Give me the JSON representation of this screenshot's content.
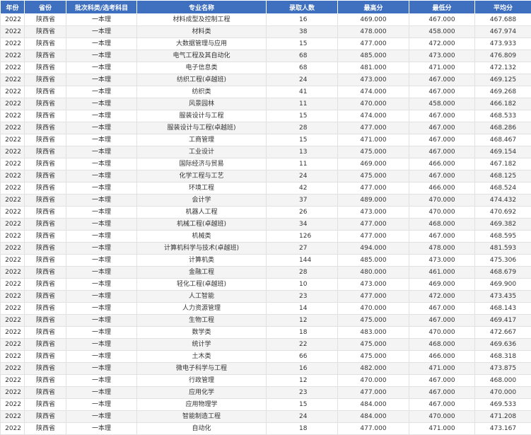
{
  "table": {
    "headers": [
      "年份",
      "省份",
      "批次科类/选考科目",
      "专业名称",
      "录取人数",
      "最高分",
      "最低分",
      "平均分"
    ],
    "rows": [
      [
        "2022",
        "陕西省",
        "一本理",
        "材料成型及控制工程",
        "16",
        "469.000",
        "467.000",
        "467.688"
      ],
      [
        "2022",
        "陕西省",
        "一本理",
        "材料类",
        "38",
        "478.000",
        "458.000",
        "467.974"
      ],
      [
        "2022",
        "陕西省",
        "一本理",
        "大数据管理与应用",
        "15",
        "477.000",
        "472.000",
        "473.933"
      ],
      [
        "2022",
        "陕西省",
        "一本理",
        "电气工程及其自动化",
        "68",
        "485.000",
        "473.000",
        "476.809"
      ],
      [
        "2022",
        "陕西省",
        "一本理",
        "电子信息类",
        "68",
        "481.000",
        "471.000",
        "472.132"
      ],
      [
        "2022",
        "陕西省",
        "一本理",
        "纺织工程(卓越班)",
        "24",
        "473.000",
        "467.000",
        "469.125"
      ],
      [
        "2022",
        "陕西省",
        "一本理",
        "纺织类",
        "41",
        "474.000",
        "467.000",
        "469.268"
      ],
      [
        "2022",
        "陕西省",
        "一本理",
        "风景园林",
        "11",
        "470.000",
        "458.000",
        "466.182"
      ],
      [
        "2022",
        "陕西省",
        "一本理",
        "服装设计与工程",
        "15",
        "474.000",
        "467.000",
        "468.533"
      ],
      [
        "2022",
        "陕西省",
        "一本理",
        "服装设计与工程(卓越班)",
        "28",
        "477.000",
        "467.000",
        "468.286"
      ],
      [
        "2022",
        "陕西省",
        "一本理",
        "工商管理",
        "15",
        "471.000",
        "467.000",
        "468.467"
      ],
      [
        "2022",
        "陕西省",
        "一本理",
        "工业设计",
        "13",
        "475.000",
        "467.000",
        "469.154"
      ],
      [
        "2022",
        "陕西省",
        "一本理",
        "国际经济与贸易",
        "11",
        "469.000",
        "466.000",
        "467.182"
      ],
      [
        "2022",
        "陕西省",
        "一本理",
        "化学工程与工艺",
        "24",
        "475.000",
        "467.000",
        "468.125"
      ],
      [
        "2022",
        "陕西省",
        "一本理",
        "环境工程",
        "42",
        "477.000",
        "466.000",
        "468.524"
      ],
      [
        "2022",
        "陕西省",
        "一本理",
        "会计学",
        "37",
        "489.000",
        "470.000",
        "474.432"
      ],
      [
        "2022",
        "陕西省",
        "一本理",
        "机器人工程",
        "26",
        "473.000",
        "470.000",
        "470.692"
      ],
      [
        "2022",
        "陕西省",
        "一本理",
        "机械工程(卓越班)",
        "34",
        "477.000",
        "468.000",
        "469.382"
      ],
      [
        "2022",
        "陕西省",
        "一本理",
        "机械类",
        "126",
        "477.000",
        "467.000",
        "468.595"
      ],
      [
        "2022",
        "陕西省",
        "一本理",
        "计算机科学与技术(卓越班)",
        "27",
        "494.000",
        "478.000",
        "481.593"
      ],
      [
        "2022",
        "陕西省",
        "一本理",
        "计算机类",
        "144",
        "485.000",
        "473.000",
        "475.306"
      ],
      [
        "2022",
        "陕西省",
        "一本理",
        "金融工程",
        "28",
        "480.000",
        "461.000",
        "468.679"
      ],
      [
        "2022",
        "陕西省",
        "一本理",
        "轻化工程(卓越班)",
        "10",
        "473.000",
        "469.000",
        "469.900"
      ],
      [
        "2022",
        "陕西省",
        "一本理",
        "人工智能",
        "23",
        "477.000",
        "472.000",
        "473.435"
      ],
      [
        "2022",
        "陕西省",
        "一本理",
        "人力资源管理",
        "14",
        "470.000",
        "467.000",
        "468.143"
      ],
      [
        "2022",
        "陕西省",
        "一本理",
        "生物工程",
        "12",
        "475.000",
        "467.000",
        "469.417"
      ],
      [
        "2022",
        "陕西省",
        "一本理",
        "数学类",
        "18",
        "483.000",
        "470.000",
        "472.667"
      ],
      [
        "2022",
        "陕西省",
        "一本理",
        "统计学",
        "22",
        "475.000",
        "468.000",
        "469.636"
      ],
      [
        "2022",
        "陕西省",
        "一本理",
        "土木类",
        "66",
        "475.000",
        "466.000",
        "468.318"
      ],
      [
        "2022",
        "陕西省",
        "一本理",
        "微电子科学与工程",
        "16",
        "482.000",
        "471.000",
        "473.875"
      ],
      [
        "2022",
        "陕西省",
        "一本理",
        "行政管理",
        "12",
        "470.000",
        "467.000",
        "468.000"
      ],
      [
        "2022",
        "陕西省",
        "一本理",
        "应用化学",
        "23",
        "477.000",
        "467.000",
        "470.000"
      ],
      [
        "2022",
        "陕西省",
        "一本理",
        "应用物理学",
        "15",
        "484.000",
        "467.000",
        "469.533"
      ],
      [
        "2022",
        "陕西省",
        "一本理",
        "智能制造工程",
        "24",
        "484.000",
        "470.000",
        "471.208"
      ],
      [
        "2022",
        "陕西省",
        "一本理",
        "自动化",
        "18",
        "477.000",
        "471.000",
        "473.167"
      ]
    ]
  }
}
